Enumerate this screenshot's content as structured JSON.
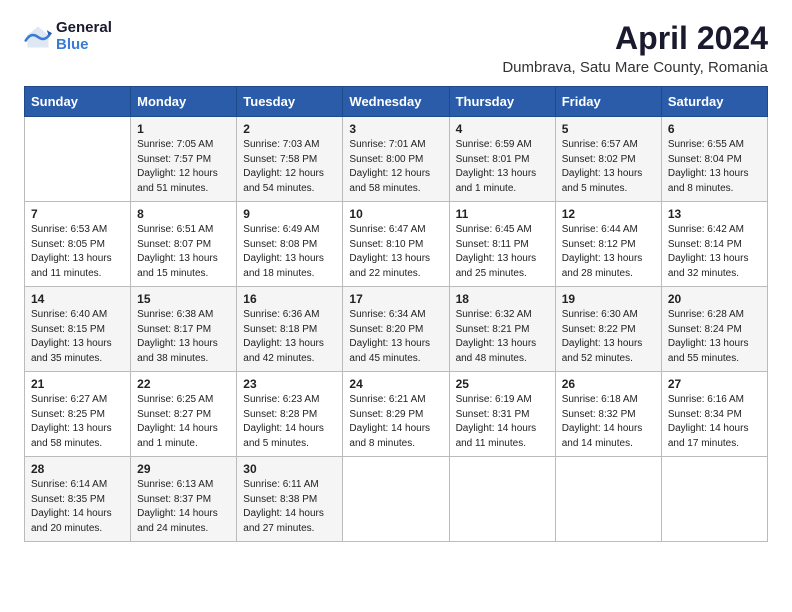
{
  "logo": {
    "general": "General",
    "blue": "Blue"
  },
  "title": "April 2024",
  "subtitle": "Dumbrava, Satu Mare County, Romania",
  "weekdays": [
    "Sunday",
    "Monday",
    "Tuesday",
    "Wednesday",
    "Thursday",
    "Friday",
    "Saturday"
  ],
  "weeks": [
    [
      {
        "day": "",
        "info": ""
      },
      {
        "day": "1",
        "info": "Sunrise: 7:05 AM\nSunset: 7:57 PM\nDaylight: 12 hours\nand 51 minutes."
      },
      {
        "day": "2",
        "info": "Sunrise: 7:03 AM\nSunset: 7:58 PM\nDaylight: 12 hours\nand 54 minutes."
      },
      {
        "day": "3",
        "info": "Sunrise: 7:01 AM\nSunset: 8:00 PM\nDaylight: 12 hours\nand 58 minutes."
      },
      {
        "day": "4",
        "info": "Sunrise: 6:59 AM\nSunset: 8:01 PM\nDaylight: 13 hours\nand 1 minute."
      },
      {
        "day": "5",
        "info": "Sunrise: 6:57 AM\nSunset: 8:02 PM\nDaylight: 13 hours\nand 5 minutes."
      },
      {
        "day": "6",
        "info": "Sunrise: 6:55 AM\nSunset: 8:04 PM\nDaylight: 13 hours\nand 8 minutes."
      }
    ],
    [
      {
        "day": "7",
        "info": "Sunrise: 6:53 AM\nSunset: 8:05 PM\nDaylight: 13 hours\nand 11 minutes."
      },
      {
        "day": "8",
        "info": "Sunrise: 6:51 AM\nSunset: 8:07 PM\nDaylight: 13 hours\nand 15 minutes."
      },
      {
        "day": "9",
        "info": "Sunrise: 6:49 AM\nSunset: 8:08 PM\nDaylight: 13 hours\nand 18 minutes."
      },
      {
        "day": "10",
        "info": "Sunrise: 6:47 AM\nSunset: 8:10 PM\nDaylight: 13 hours\nand 22 minutes."
      },
      {
        "day": "11",
        "info": "Sunrise: 6:45 AM\nSunset: 8:11 PM\nDaylight: 13 hours\nand 25 minutes."
      },
      {
        "day": "12",
        "info": "Sunrise: 6:44 AM\nSunset: 8:12 PM\nDaylight: 13 hours\nand 28 minutes."
      },
      {
        "day": "13",
        "info": "Sunrise: 6:42 AM\nSunset: 8:14 PM\nDaylight: 13 hours\nand 32 minutes."
      }
    ],
    [
      {
        "day": "14",
        "info": "Sunrise: 6:40 AM\nSunset: 8:15 PM\nDaylight: 13 hours\nand 35 minutes."
      },
      {
        "day": "15",
        "info": "Sunrise: 6:38 AM\nSunset: 8:17 PM\nDaylight: 13 hours\nand 38 minutes."
      },
      {
        "day": "16",
        "info": "Sunrise: 6:36 AM\nSunset: 8:18 PM\nDaylight: 13 hours\nand 42 minutes."
      },
      {
        "day": "17",
        "info": "Sunrise: 6:34 AM\nSunset: 8:20 PM\nDaylight: 13 hours\nand 45 minutes."
      },
      {
        "day": "18",
        "info": "Sunrise: 6:32 AM\nSunset: 8:21 PM\nDaylight: 13 hours\nand 48 minutes."
      },
      {
        "day": "19",
        "info": "Sunrise: 6:30 AM\nSunset: 8:22 PM\nDaylight: 13 hours\nand 52 minutes."
      },
      {
        "day": "20",
        "info": "Sunrise: 6:28 AM\nSunset: 8:24 PM\nDaylight: 13 hours\nand 55 minutes."
      }
    ],
    [
      {
        "day": "21",
        "info": "Sunrise: 6:27 AM\nSunset: 8:25 PM\nDaylight: 13 hours\nand 58 minutes."
      },
      {
        "day": "22",
        "info": "Sunrise: 6:25 AM\nSunset: 8:27 PM\nDaylight: 14 hours\nand 1 minute."
      },
      {
        "day": "23",
        "info": "Sunrise: 6:23 AM\nSunset: 8:28 PM\nDaylight: 14 hours\nand 5 minutes."
      },
      {
        "day": "24",
        "info": "Sunrise: 6:21 AM\nSunset: 8:29 PM\nDaylight: 14 hours\nand 8 minutes."
      },
      {
        "day": "25",
        "info": "Sunrise: 6:19 AM\nSunset: 8:31 PM\nDaylight: 14 hours\nand 11 minutes."
      },
      {
        "day": "26",
        "info": "Sunrise: 6:18 AM\nSunset: 8:32 PM\nDaylight: 14 hours\nand 14 minutes."
      },
      {
        "day": "27",
        "info": "Sunrise: 6:16 AM\nSunset: 8:34 PM\nDaylight: 14 hours\nand 17 minutes."
      }
    ],
    [
      {
        "day": "28",
        "info": "Sunrise: 6:14 AM\nSunset: 8:35 PM\nDaylight: 14 hours\nand 20 minutes."
      },
      {
        "day": "29",
        "info": "Sunrise: 6:13 AM\nSunset: 8:37 PM\nDaylight: 14 hours\nand 24 minutes."
      },
      {
        "day": "30",
        "info": "Sunrise: 6:11 AM\nSunset: 8:38 PM\nDaylight: 14 hours\nand 27 minutes."
      },
      {
        "day": "",
        "info": ""
      },
      {
        "day": "",
        "info": ""
      },
      {
        "day": "",
        "info": ""
      },
      {
        "day": "",
        "info": ""
      }
    ]
  ]
}
